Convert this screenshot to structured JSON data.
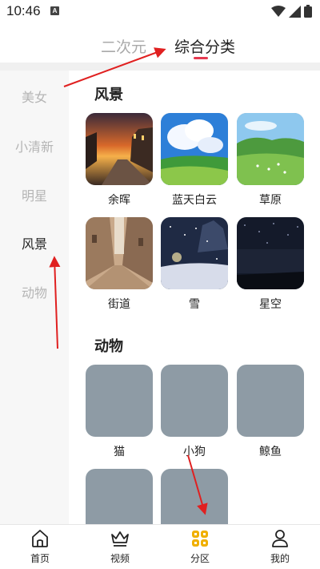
{
  "status_bar": {
    "time": "10:46",
    "notification_letter": "A"
  },
  "top_tabs": [
    {
      "label": "二次元",
      "active": false
    },
    {
      "label": "综合分类",
      "active": true
    }
  ],
  "sidebar": {
    "items": [
      {
        "label": "美女",
        "active": false
      },
      {
        "label": "小清新",
        "active": false
      },
      {
        "label": "明星",
        "active": false
      },
      {
        "label": "风景",
        "active": true
      },
      {
        "label": "动物",
        "active": false
      }
    ]
  },
  "sections": [
    {
      "title": "风景",
      "cards": [
        {
          "label": "余晖",
          "image": "sunset-street-photo"
        },
        {
          "label": "蓝天白云",
          "image": "blue-sky-clouds-photo"
        },
        {
          "label": "草原",
          "image": "grassland-photo"
        },
        {
          "label": "街道",
          "image": "old-street-photo"
        },
        {
          "label": "雪",
          "image": "snow-night-photo"
        },
        {
          "label": "星空",
          "image": "starry-sky-photo"
        }
      ]
    },
    {
      "title": "动物",
      "cards": [
        {
          "label": "猫",
          "image": "placeholder"
        },
        {
          "label": "小狗",
          "image": "placeholder"
        },
        {
          "label": "鲸鱼",
          "image": "placeholder"
        },
        {
          "label": "",
          "image": "placeholder"
        },
        {
          "label": "",
          "image": "placeholder"
        }
      ]
    }
  ],
  "bottom_nav": [
    {
      "label": "首页",
      "icon": "home-icon"
    },
    {
      "label": "视频",
      "icon": "crown-icon"
    },
    {
      "label": "分区",
      "icon": "grid-icon",
      "active": true
    },
    {
      "label": "我的",
      "icon": "person-icon"
    }
  ],
  "colors": {
    "accent": "#e53950",
    "placeholder": "#8e9ba5",
    "nav_active": "#f0b000",
    "arrow": "#e02020"
  }
}
